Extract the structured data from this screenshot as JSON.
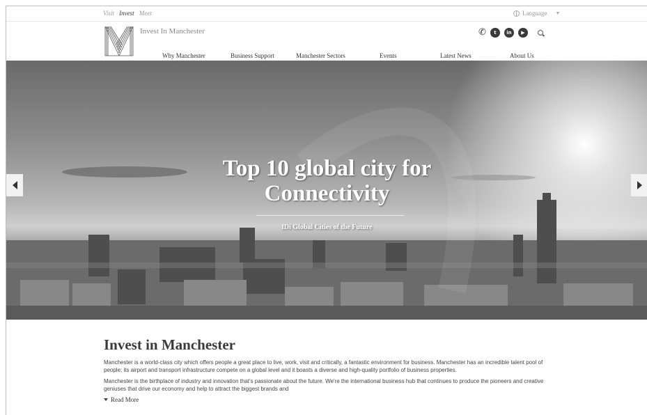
{
  "utility": {
    "links": [
      "Visit",
      "Invest",
      "Meet"
    ],
    "active": "Invest",
    "language_label": "Language"
  },
  "header": {
    "site_name": "Invest In Manchester",
    "nav": [
      "Why Manchester",
      "Business Support",
      "Manchester Sectors",
      "Events",
      "Latest News",
      "About Us"
    ],
    "icons": [
      "phone-icon",
      "twitter-icon",
      "linkedin-icon",
      "youtube-icon",
      "search-icon"
    ]
  },
  "hero": {
    "title_line1": "Top 10 global city for",
    "title_line2": "Connectivity",
    "subtitle": "fDi Global Cities of the Future"
  },
  "content": {
    "heading": "Invest in Manchester",
    "paragraph1": "Manchester is a world-class city which offers people a great place to live, work, visit and critically, a fantastic environment for business. Manchester has an incredible talent pool of people; its airport and transport infrastructure compete on a global level and it boasts a diverse and high-quality portfolio of business properties.",
    "paragraph2": "Manchester is the birthplace of industry and innovation that's passionate about the future. We're the international business hub that continues to produce the pioneers and creative geniuses that drive our economy and help to attract the biggest brands and",
    "read_more": "Read More"
  }
}
